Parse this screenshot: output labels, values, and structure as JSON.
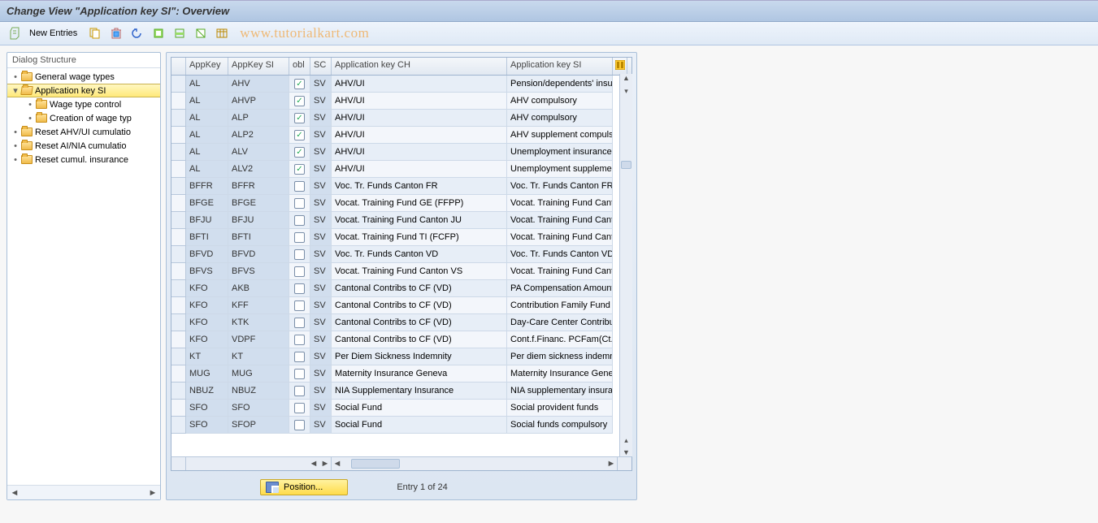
{
  "title": "Change View \"Application key SI\": Overview",
  "watermark": "www.tutorialkart.com",
  "toolbar": {
    "new_entries_label": "New Entries"
  },
  "tree": {
    "header": "Dialog Structure",
    "items": [
      {
        "label": "General wage types",
        "level": 0,
        "open": false,
        "twisty": "•"
      },
      {
        "label": "Application key SI",
        "level": 0,
        "open": true,
        "twisty": "▾",
        "selected": true
      },
      {
        "label": "Wage type control",
        "level": 1,
        "open": false,
        "twisty": "•"
      },
      {
        "label": "Creation of wage typ",
        "level": 1,
        "open": false,
        "twisty": "•"
      },
      {
        "label": "Reset AHV/UI cumulatio",
        "level": 0,
        "open": false,
        "twisty": "•"
      },
      {
        "label": "Reset AI/NIA cumulatio",
        "level": 0,
        "open": false,
        "twisty": "•"
      },
      {
        "label": "Reset cumul. insurance",
        "level": 0,
        "open": false,
        "twisty": "•"
      }
    ]
  },
  "table": {
    "columns": {
      "appkey": "AppKey",
      "appkey_si": "AppKey SI",
      "obl": "obl",
      "sc": "SC",
      "appkey_ch": "Application key CH",
      "appkey_si_desc": "Application key SI"
    },
    "rows": [
      {
        "appkey": "AL",
        "appkey_si": "AHV",
        "obl": true,
        "sc": "SV",
        "ch": "AHV/UI",
        "si": "Pension/dependents' insur"
      },
      {
        "appkey": "AL",
        "appkey_si": "AHVP",
        "obl": true,
        "sc": "SV",
        "ch": "AHV/UI",
        "si": "AHV compulsory"
      },
      {
        "appkey": "AL",
        "appkey_si": "ALP",
        "obl": true,
        "sc": "SV",
        "ch": "AHV/UI",
        "si": "AHV compulsory"
      },
      {
        "appkey": "AL",
        "appkey_si": "ALP2",
        "obl": true,
        "sc": "SV",
        "ch": "AHV/UI",
        "si": "AHV supplement compulso"
      },
      {
        "appkey": "AL",
        "appkey_si": "ALV",
        "obl": true,
        "sc": "SV",
        "ch": "AHV/UI",
        "si": "Unemployment insurance"
      },
      {
        "appkey": "AL",
        "appkey_si": "ALV2",
        "obl": true,
        "sc": "SV",
        "ch": "AHV/UI",
        "si": "Unemployment supplemen"
      },
      {
        "appkey": "BFFR",
        "appkey_si": "BFFR",
        "obl": false,
        "sc": "SV",
        "ch": "Voc. Tr. Funds Canton FR",
        "si": "Voc. Tr. Funds Canton FR"
      },
      {
        "appkey": "BFGE",
        "appkey_si": "BFGE",
        "obl": false,
        "sc": "SV",
        "ch": "Vocat. Training Fund GE (FFPP)",
        "si": "Vocat. Training Fund Cant"
      },
      {
        "appkey": "BFJU",
        "appkey_si": "BFJU",
        "obl": false,
        "sc": "SV",
        "ch": "Vocat. Training Fund Canton JU",
        "si": "Vocat. Training Fund Cant"
      },
      {
        "appkey": "BFTI",
        "appkey_si": "BFTI",
        "obl": false,
        "sc": "SV",
        "ch": "Vocat. Training Fund TI (FCFP)",
        "si": "Vocat. Training Fund Cant"
      },
      {
        "appkey": "BFVD",
        "appkey_si": "BFVD",
        "obl": false,
        "sc": "SV",
        "ch": "Voc. Tr. Funds Canton VD",
        "si": "Voc. Tr. Funds Canton VD"
      },
      {
        "appkey": "BFVS",
        "appkey_si": "BFVS",
        "obl": false,
        "sc": "SV",
        "ch": "Vocat. Training Fund Canton VS",
        "si": "Vocat. Training Fund Cant"
      },
      {
        "appkey": "KFO",
        "appkey_si": "AKB",
        "obl": false,
        "sc": "SV",
        "ch": "Cantonal Contribs to CF (VD)",
        "si": "PA Compensation Amount"
      },
      {
        "appkey": "KFO",
        "appkey_si": "KFF",
        "obl": false,
        "sc": "SV",
        "ch": "Cantonal Contribs to CF (VD)",
        "si": "Contribution Family Fund V"
      },
      {
        "appkey": "KFO",
        "appkey_si": "KTK",
        "obl": false,
        "sc": "SV",
        "ch": "Cantonal Contribs to CF (VD)",
        "si": "Day-Care Center Contribut"
      },
      {
        "appkey": "KFO",
        "appkey_si": "VDPF",
        "obl": false,
        "sc": "SV",
        "ch": "Cantonal Contribs to CF (VD)",
        "si": "Cont.f.Financ. PCFam(Ct.V"
      },
      {
        "appkey": "KT",
        "appkey_si": "KT",
        "obl": false,
        "sc": "SV",
        "ch": "Per Diem Sickness Indemnity",
        "si": "Per diem sickness indemnit"
      },
      {
        "appkey": "MUG",
        "appkey_si": "MUG",
        "obl": false,
        "sc": "SV",
        "ch": "Maternity Insurance Geneva",
        "si": "Maternity Insurance Genev"
      },
      {
        "appkey": "NBUZ",
        "appkey_si": "NBUZ",
        "obl": false,
        "sc": "SV",
        "ch": "NIA Supplementary Insurance",
        "si": "NIA supplementary insuran"
      },
      {
        "appkey": "SFO",
        "appkey_si": "SFO",
        "obl": false,
        "sc": "SV",
        "ch": "Social Fund",
        "si": "Social provident funds"
      },
      {
        "appkey": "SFO",
        "appkey_si": "SFOP",
        "obl": false,
        "sc": "SV",
        "ch": "Social Fund",
        "si": "Social funds compulsory"
      }
    ]
  },
  "footer": {
    "position_label": "Position...",
    "entry_text": "Entry 1 of 24"
  }
}
